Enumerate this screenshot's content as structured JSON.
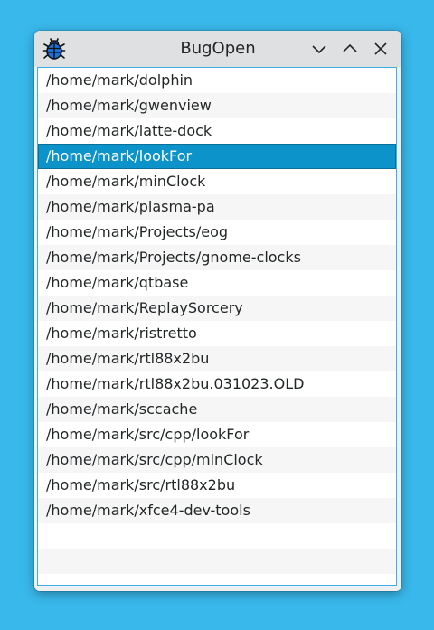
{
  "window": {
    "title": "BugOpen",
    "icon": "bug-icon",
    "controls": [
      "minimize-icon",
      "maximize-icon",
      "close-icon"
    ]
  },
  "list": {
    "items": [
      "/home/mark/dolphin",
      "/home/mark/gwenview",
      "/home/mark/latte-dock",
      "/home/mark/lookFor",
      "/home/mark/minClock",
      "/home/mark/plasma-pa",
      "/home/mark/Projects/eog",
      "/home/mark/Projects/gnome-clocks",
      "/home/mark/qtbase",
      "/home/mark/ReplaySorcery",
      "/home/mark/ristretto",
      "/home/mark/rtl88x2bu",
      "/home/mark/rtl88x2bu.031023.OLD",
      "/home/mark/sccache",
      "/home/mark/src/cpp/lookFor",
      "/home/mark/src/cpp/minClock",
      "/home/mark/src/rtl88x2bu",
      "/home/mark/xfce4-dev-tools"
    ],
    "selected_index": 3
  },
  "colors": {
    "desktop": "#39b8eb",
    "selection": "#0c93c9",
    "icon_blue": "#1e6fd9"
  }
}
